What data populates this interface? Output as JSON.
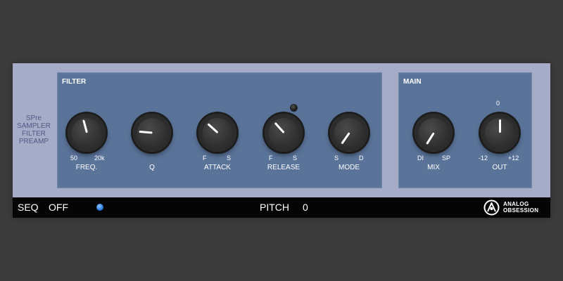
{
  "sidebar": {
    "lines": [
      "SPre",
      "SAMPLER",
      "FILTER",
      "PREAMP"
    ]
  },
  "filter": {
    "title": "FILTER",
    "freq": {
      "label": "FREQ.",
      "min": "50",
      "max": "20k",
      "rotation_deg": -15
    },
    "q": {
      "label": "Q",
      "rotation_deg": -85
    },
    "attack": {
      "label": "ATTACK",
      "min": "F",
      "max": "S",
      "rotation_deg": -48
    },
    "release": {
      "label": "RELEASE",
      "min": "F",
      "max": "S",
      "rotation_deg": -42
    },
    "mode": {
      "label": "MODE",
      "min": "S",
      "max": "D",
      "rotation_deg": -145
    }
  },
  "main": {
    "title": "MAIN",
    "mix": {
      "label": "MIX",
      "min": "DI",
      "max": "SP",
      "rotation_deg": -148
    },
    "out": {
      "label": "OUT",
      "min": "-12",
      "max": "+12",
      "center": "0",
      "rotation_deg": 0
    }
  },
  "footer": {
    "seq_label": "SEQ",
    "seq_value": "OFF",
    "pitch_label": "PITCH",
    "pitch_value": "0",
    "logo_line1": "ANALOG",
    "logo_line2": "OBSESSION"
  },
  "colors": {
    "panel": "#5a7399",
    "chassis": "#a6abc8",
    "led_blue": "#2d7fe3"
  }
}
